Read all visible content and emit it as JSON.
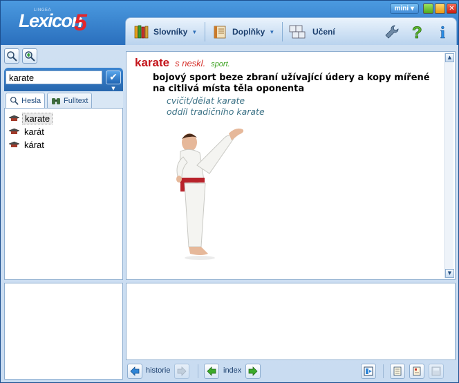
{
  "app": {
    "logo_small": "LINGEA",
    "logo_text": "Lexicon",
    "logo_number": "5",
    "mini_label": "mini",
    "close_glyph": "✕"
  },
  "toolbar": {
    "slovniky": "Slovníky",
    "doplnky": "Doplňky",
    "uceni": "Učení"
  },
  "search": {
    "value": "karate",
    "go_glyph": "✔"
  },
  "tabs": {
    "hesla": "Hesla",
    "fulltext": "Fulltext"
  },
  "word_list": [
    "karate",
    "karát",
    "kárat"
  ],
  "entry": {
    "headword": "karate",
    "grammar": "s neskl.",
    "domain": "sport.",
    "definition": "bojový sport beze zbraní užívající údery a kopy mířené na citlivá místa těla oponenta",
    "examples": [
      "cvičit/dělat karate",
      "oddíl tradičního karate"
    ]
  },
  "bottom": {
    "historie": "historie",
    "index": "index"
  },
  "colors": {
    "headword": "#c4161c",
    "domain": "#3aa11f",
    "example": "#3c7286"
  }
}
